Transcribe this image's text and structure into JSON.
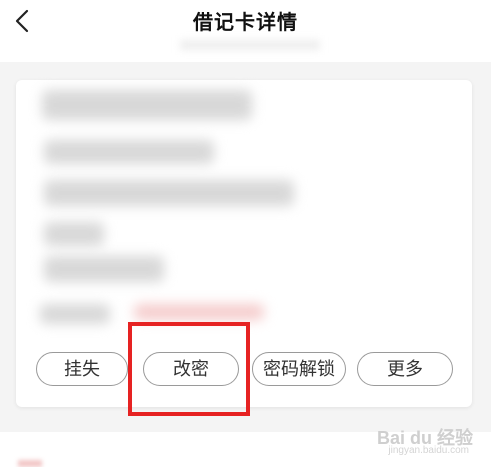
{
  "header": {
    "title": "借记卡详情",
    "back_icon": "chevron-left-icon"
  },
  "card": {
    "actions": [
      {
        "label": "挂失"
      },
      {
        "label": "改密"
      },
      {
        "label": "密码解锁"
      },
      {
        "label": "更多"
      }
    ]
  },
  "highlight": {
    "color": "#e62222"
  },
  "watermark": {
    "text": "Bai du 经验",
    "sub": "jingyan.baidu.com"
  }
}
